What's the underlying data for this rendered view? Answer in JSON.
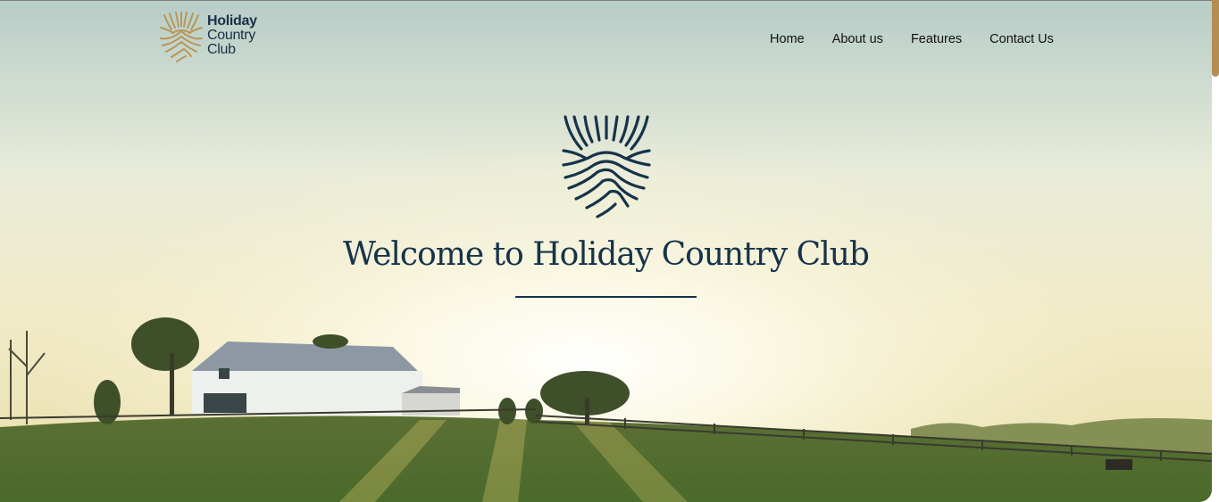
{
  "brand": {
    "name_line1": "Holiday",
    "name_line2": "Country",
    "name_line3": "Club"
  },
  "nav": {
    "items": [
      {
        "label": "Home"
      },
      {
        "label": "About us"
      },
      {
        "label": "Features"
      },
      {
        "label": "Contact Us"
      }
    ]
  },
  "hero": {
    "title": "Welcome to Holiday Country Club"
  },
  "colors": {
    "navy": "#16334a",
    "gold": "#b38d52"
  }
}
